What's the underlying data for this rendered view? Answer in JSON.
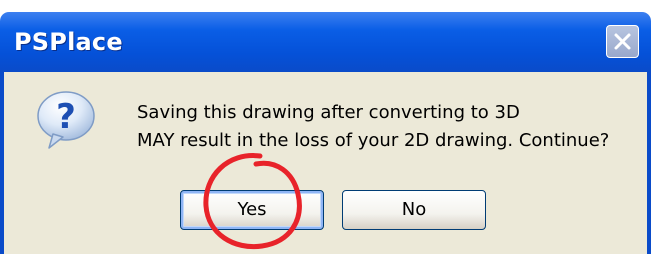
{
  "window": {
    "title": "PSPlace"
  },
  "dialog": {
    "icon": "question-icon",
    "message_line1": "Saving this drawing after converting to 3D",
    "message_line2": "MAY result in the loss of your 2D drawing. Continue?"
  },
  "buttons": {
    "yes_label": "Yes",
    "no_label": "No"
  },
  "colors": {
    "titlebar": "#0a5ee6",
    "dialog_bg": "#ece9d8",
    "annotation_circle": "#e8232a"
  }
}
